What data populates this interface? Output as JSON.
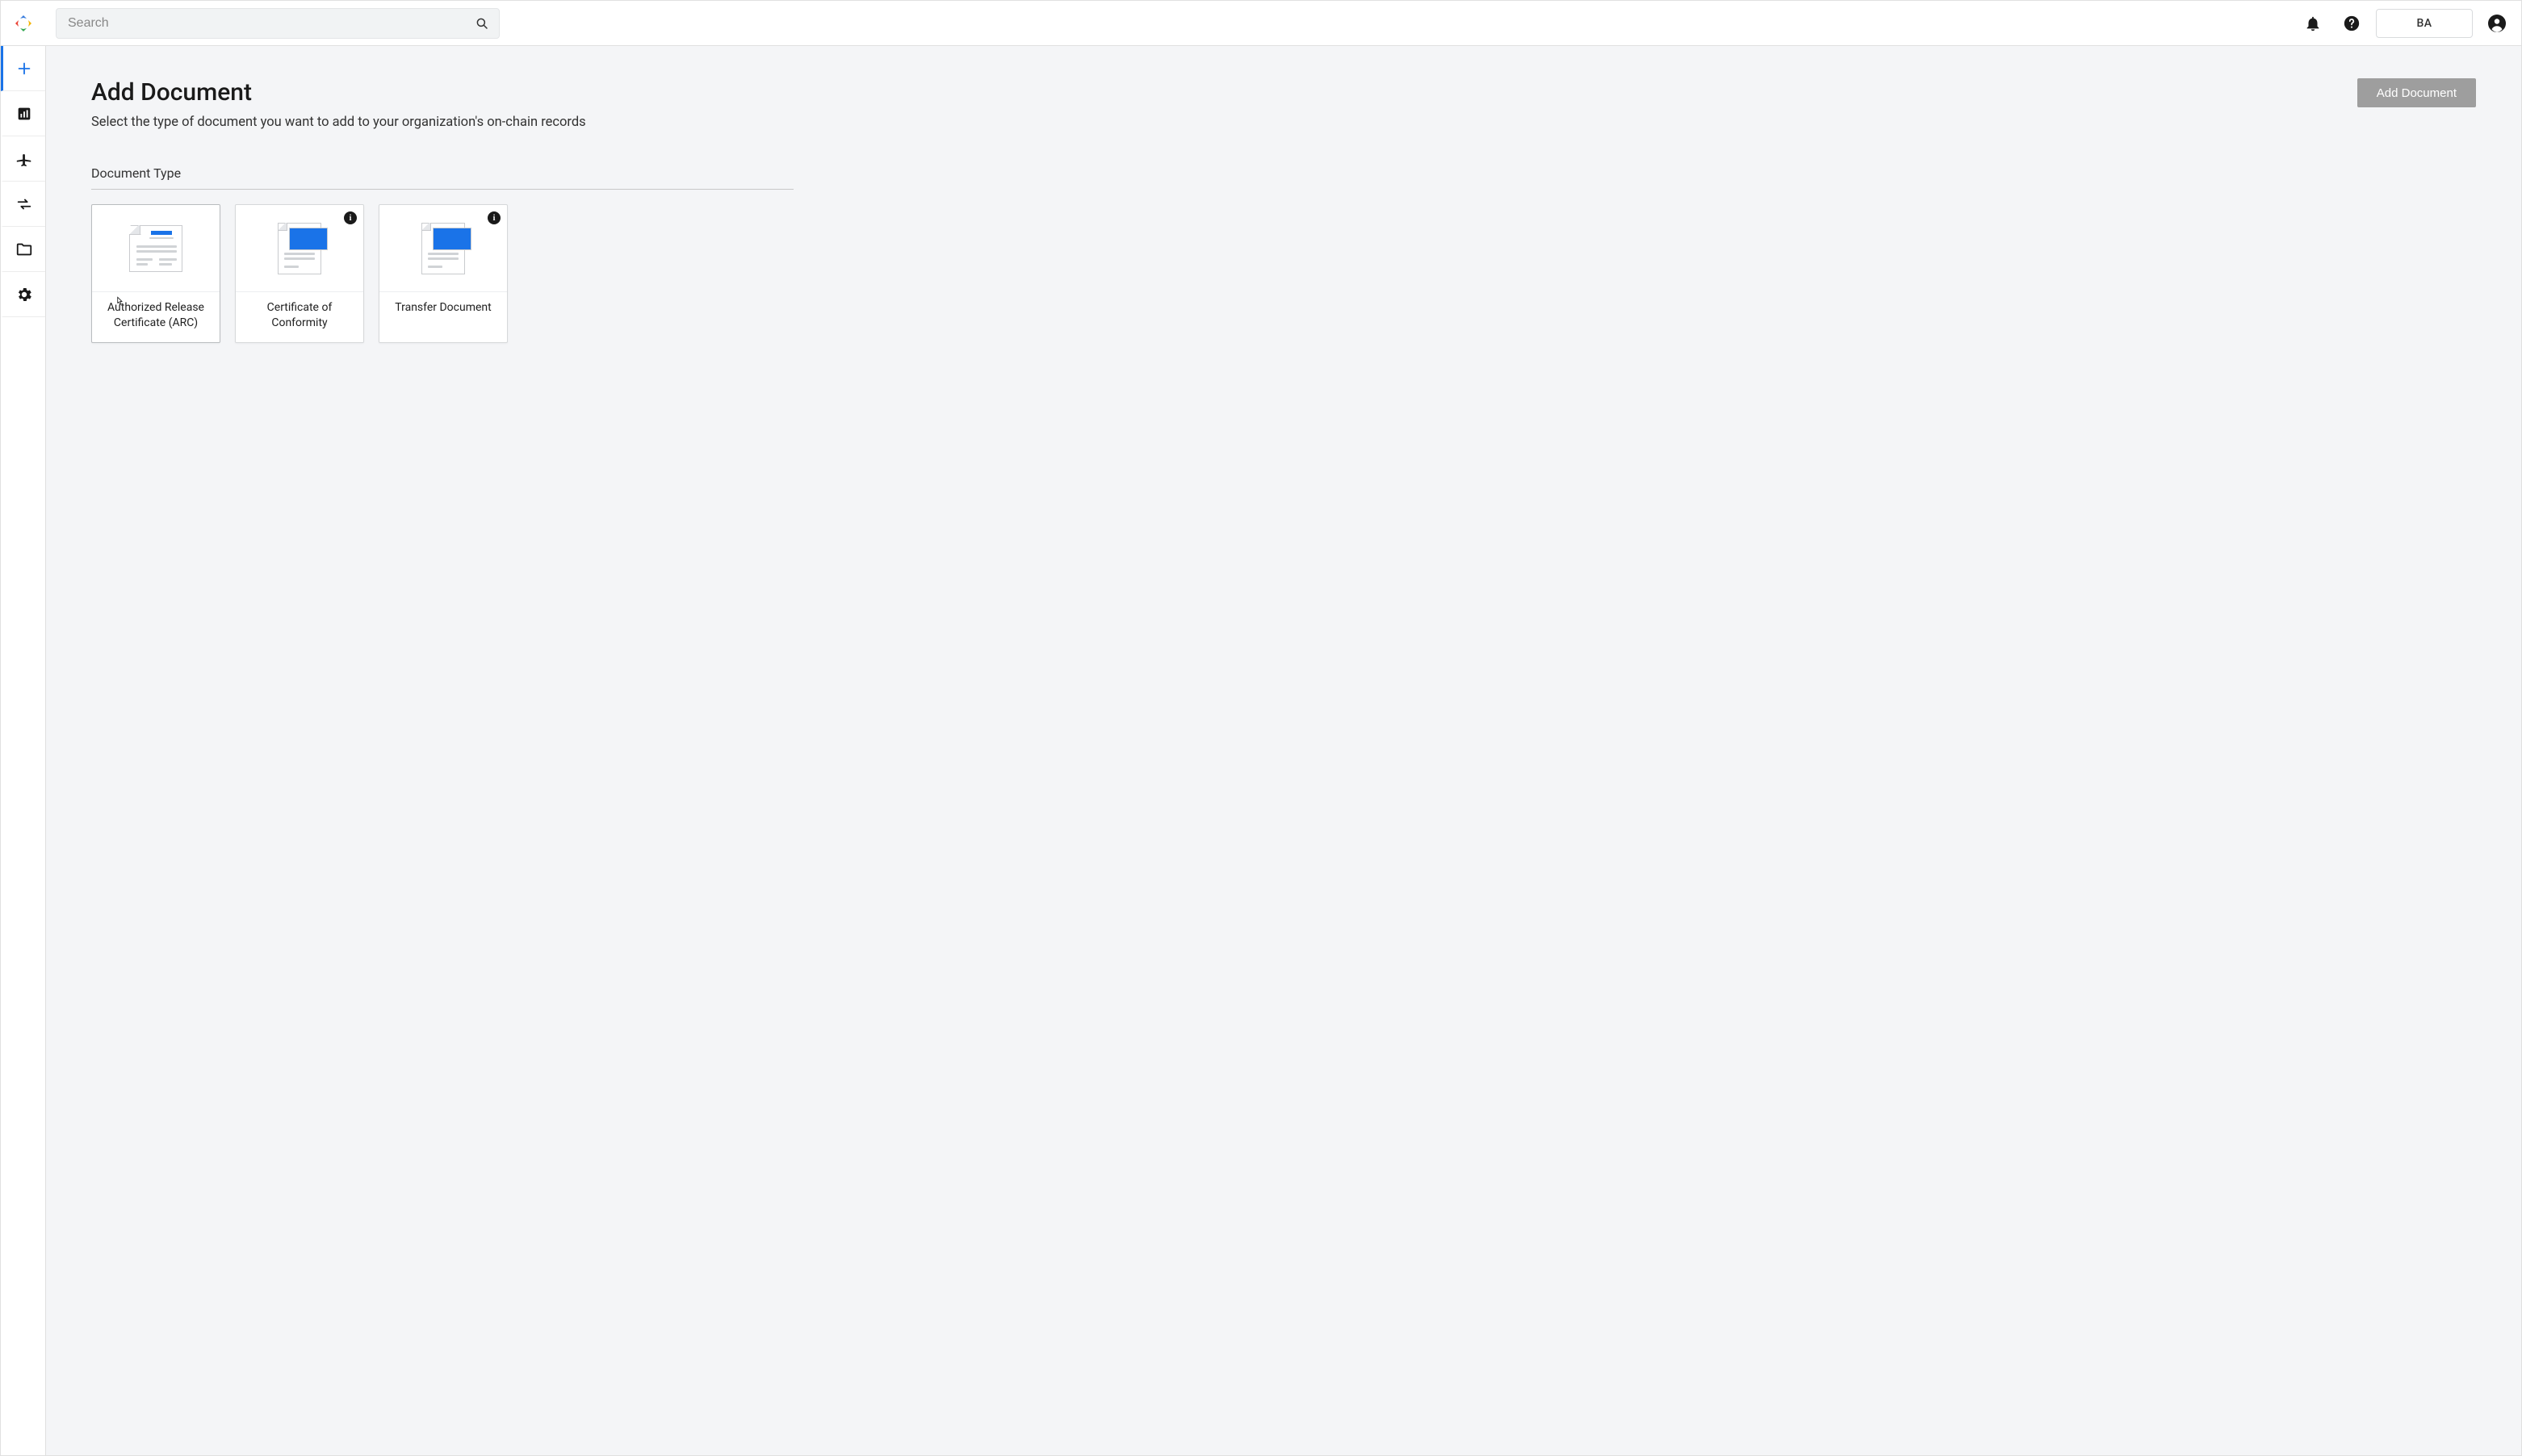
{
  "header": {
    "search_placeholder": "Search",
    "user_initials": "BA"
  },
  "sidebar": {
    "items": [
      {
        "name": "add",
        "active": true
      },
      {
        "name": "dashboard",
        "active": false
      },
      {
        "name": "flights",
        "active": false
      },
      {
        "name": "transfer",
        "active": false
      },
      {
        "name": "folder",
        "active": false
      },
      {
        "name": "settings",
        "active": false
      }
    ]
  },
  "page": {
    "title": "Add Document",
    "subtitle": "Select the type of document you want to add to your organization's on-chain records",
    "primary_button": "Add Document",
    "section_label": "Document Type"
  },
  "cards": [
    {
      "label": "Authorized Release Certificate (ARC)",
      "info": false,
      "selected": true
    },
    {
      "label": "Certificate of Conformity",
      "info": true,
      "selected": false
    },
    {
      "label": "Transfer Document",
      "info": true,
      "selected": false
    }
  ]
}
